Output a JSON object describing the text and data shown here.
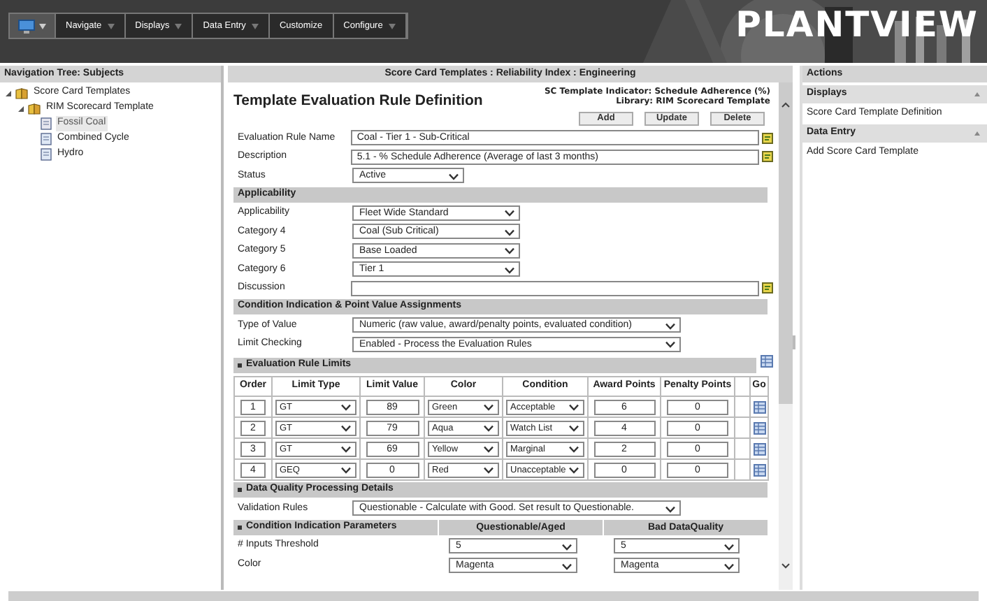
{
  "menu": {
    "items": [
      {
        "label": "Navigate",
        "has_menu": true
      },
      {
        "label": "Displays",
        "has_menu": true
      },
      {
        "label": "Data Entry",
        "has_menu": true
      },
      {
        "label": "Customize",
        "has_menu": false
      },
      {
        "label": "Configure",
        "has_menu": true
      }
    ]
  },
  "logo": "PLANTVIEW",
  "navigation": {
    "title": "Navigation Tree: Subjects",
    "tree": [
      {
        "label": "Score Card Templates",
        "expanded": true,
        "children": [
          {
            "label": "RIM Scorecard Template",
            "expanded": true,
            "children": [
              {
                "label": "Fossil Coal",
                "selected": true
              },
              {
                "label": "Combined Cycle",
                "selected": false
              },
              {
                "label": "Hydro",
                "selected": false
              }
            ]
          }
        ]
      }
    ]
  },
  "main": {
    "breadcrumb": "Score Card Templates : Reliability Index : Engineering",
    "title": "Template Evaluation Rule Definition",
    "indicator": "SC Template Indicator: Schedule Adherence (%)",
    "library": "Library: RIM Scorecard Template",
    "buttons": [
      "Add",
      "Update",
      "Delete"
    ],
    "form": [
      {
        "kind": "text",
        "label": "Evaluation Rule Name",
        "value": "Coal - Tier 1 - Sub-Critical",
        "note": true
      },
      {
        "kind": "text",
        "label": "Description",
        "value": "5.1 - % Schedule Adherence (Average of last 3 months)",
        "note": true
      },
      {
        "kind": "select",
        "label": "Status",
        "value": "Active"
      },
      {
        "kind": "section",
        "label": "Applicability",
        "bullet": false
      },
      {
        "kind": "select",
        "label": "Applicability",
        "value": "Fleet Wide Standard"
      },
      {
        "kind": "select",
        "label": "Category 4",
        "value": "Coal (Sub Critical)"
      },
      {
        "kind": "select",
        "label": "Category 5",
        "value": "Base Loaded"
      },
      {
        "kind": "select",
        "label": "Category 6",
        "value": "Tier 1"
      },
      {
        "kind": "text",
        "label": "Discussion",
        "note": true
      },
      {
        "kind": "section",
        "label": "Condition Indication & Point Value Assignments",
        "bullet": false
      },
      {
        "kind": "select",
        "label": "Type of Value",
        "value": "Numeric (raw value, award/penalty points, evaluated condition)"
      },
      {
        "kind": "select",
        "label": "Limit Checking",
        "value": "Enabled - Process the Evaluation Rules"
      },
      {
        "kind": "limits",
        "label": "Evaluation Rule Limits",
        "bullet": true,
        "columns": [
          "Order",
          "Limit Type",
          "Limit Value",
          "Color",
          "Condition",
          "Award Points",
          "Penalty Points",
          "Go"
        ],
        "rows": [
          {
            "order": "1",
            "limit_type": "GT",
            "limit_value": "89",
            "color_name": "Green",
            "condition": "Acceptable",
            "award_points": "6",
            "penalty_points": "0"
          },
          {
            "order": "2",
            "limit_type": "GT",
            "limit_value": "79",
            "color_name": "Aqua",
            "condition": "Watch List",
            "award_points": "4",
            "penalty_points": "0"
          },
          {
            "order": "3",
            "limit_type": "GT",
            "limit_value": "69",
            "color_name": "Yellow",
            "condition": "Marginal",
            "award_points": "2",
            "penalty_points": "0"
          },
          {
            "order": "4",
            "limit_type": "GEQ",
            "limit_value": "0",
            "color_name": "Red",
            "condition": "Unacceptable",
            "award_points": "0",
            "penalty_points": "0"
          }
        ]
      },
      {
        "kind": "section",
        "label": "Data Quality Processing Details",
        "bullet": true
      },
      {
        "kind": "select",
        "label": "Validation Rules",
        "value": "Questionable - Calculate with Good. Set result to Questionable."
      },
      {
        "kind": "parameters",
        "columns": [
          "Condition Indication Parameters",
          "Questionable/Aged",
          "Bad DataQuality"
        ],
        "bullet": true,
        "rows": [
          {
            "label": "# Inputs Threshold",
            "values": [
              "5",
              "5"
            ]
          },
          {
            "label": "Color",
            "values": [
              "Magenta",
              "Magenta"
            ]
          }
        ]
      }
    ]
  },
  "actions": {
    "title": "Actions",
    "groups": [
      {
        "title": "Displays",
        "expanded": true,
        "items": [
          "Score Card Template Definition"
        ]
      },
      {
        "title": "Data Entry",
        "expanded": true,
        "items": [
          "Add Score Card Template"
        ]
      }
    ]
  }
}
